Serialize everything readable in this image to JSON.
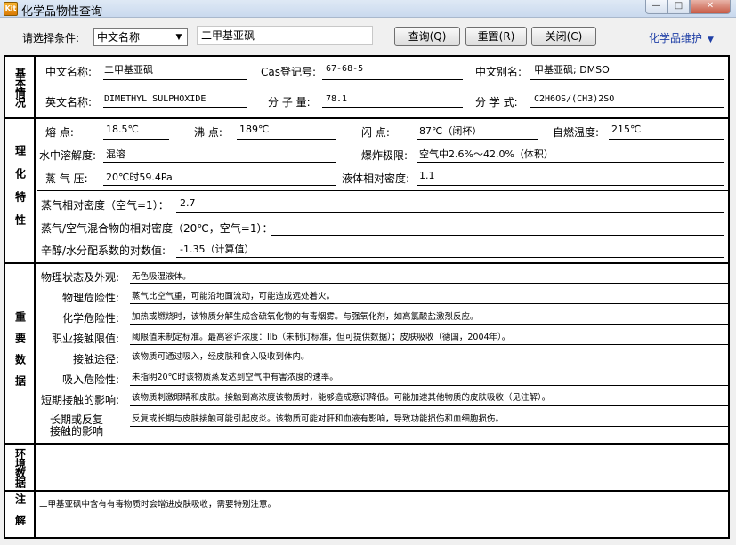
{
  "window": {
    "title": "化学品物性查询",
    "app_icon_text": "Kit"
  },
  "toolbar": {
    "condition_label": "请选择条件:",
    "condition_select_value": "中文名称",
    "query_value": "二甲基亚砜",
    "query_button": "查询(Q)",
    "reset_button": "重置(R)",
    "close_button": "关闭(C)",
    "maintain_menu": "化学品维护"
  },
  "sections": {
    "basic": "基本情况",
    "physchem": "理化特性",
    "important": "重要数据",
    "environment": "环境数据",
    "notes": "注解"
  },
  "basic": {
    "cn_name_label": "中文名称:",
    "cn_name": "二甲基亚砜",
    "cas_label": "Cas登记号:",
    "cas": "67-68-5",
    "alias_label": "中文别名:",
    "alias": "甲基亚砜; DMSO",
    "en_name_label": "英文名称:",
    "en_name": "DIMETHYL SULPHOXIDE",
    "mw_label": "分 子 量:",
    "mw": "78.1",
    "formula_label": "分 学 式:",
    "formula": "C2H6OS/(CH3)2SO"
  },
  "physchem": {
    "mp_label": "熔   点:",
    "mp": "18.5℃",
    "bp_label": "沸  点:",
    "bp": "189℃",
    "fp_label": "闪   点:",
    "fp": "87℃（闭杯）",
    "ai_label": "自燃温度:",
    "ai": "215℃",
    "sol_label": "水中溶解度:",
    "sol": "混溶",
    "expl_label": "爆炸极限:",
    "expl": "空气中2.6%～42.0%（体积）",
    "vp_label": "蒸 气 压:",
    "vp": "20℃时59.4Pa",
    "ld_label": "液体相对密度:",
    "ld": "1.1",
    "vd_label": "蒸气相对密度（空气=1）：",
    "vd": "2.7",
    "mix_label": "蒸气/空气混合物的相对密度（20℃，空气=1）：",
    "mix": "",
    "logp_label": "辛醇/水分配系数的对数值:",
    "logp": "-1.35（计算值）"
  },
  "important": {
    "rows": [
      {
        "label": "物理状态及外观:",
        "value": "无色吸湿液体。"
      },
      {
        "label": "物理危险性:",
        "value": "蒸气比空气重，可能沿地面流动，可能造成远处着火。"
      },
      {
        "label": "化学危险性:",
        "value": "加热或燃烧时，该物质分解生成含硫氧化物的有毒烟雾。与强氧化剂，如高氯酸盐激烈反应。"
      },
      {
        "label": "职业接触限值:",
        "value": "阈限值未制定标准。最高容许浓度：IIb（未制订标准，但可提供数据）；皮肤吸收（德国，2004年）。"
      },
      {
        "label": "接触途径:",
        "value": "该物质可通过吸入，经皮肤和食入吸收到体内。"
      },
      {
        "label": "吸入危险性:",
        "value": "未指明20℃时该物质蒸发达到空气中有害浓度的速率。"
      },
      {
        "label": "短期接触的影响:",
        "value": "该物质刺激眼睛和皮肤。接触到高浓度该物质时，能够造成意识降低。可能加速其他物质的皮肤吸收（见注解）。"
      },
      {
        "label": "长期或反复接触的影响:",
        "label2": "长期或反复",
        "label3": "接触的影响",
        "value": "反复或长期与皮肤接触可能引起皮炎。该物质可能对肝和血液有影响，导致功能损伤和血细胞损伤。"
      }
    ]
  },
  "notes": {
    "text": "二甲基亚砜中含有有毒物质时会增进皮肤吸收，需要特别注意。"
  },
  "icons": {
    "minimize": "—",
    "maximize": "□",
    "close": "✕",
    "caret": "▼",
    "dropdown": "▼"
  }
}
